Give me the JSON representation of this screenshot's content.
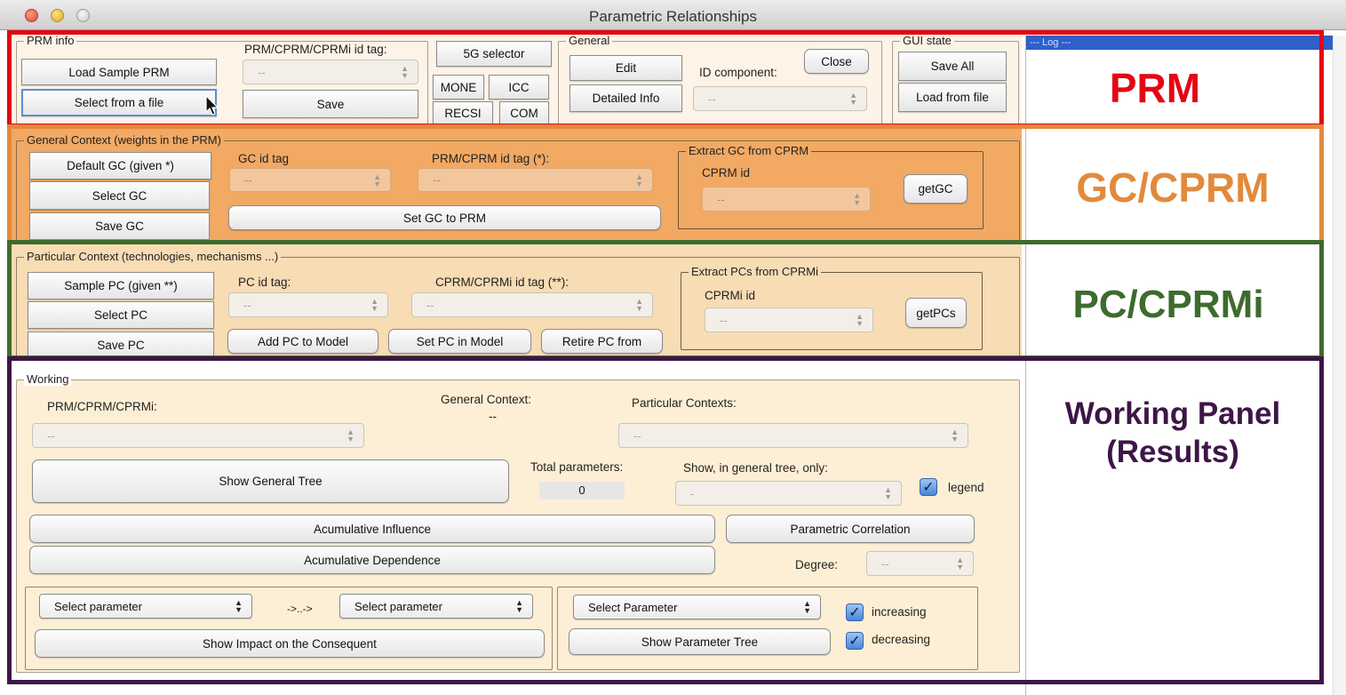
{
  "window": {
    "title": "Parametric Relationships"
  },
  "colors": {
    "prm": "#e30613",
    "gc": "#e28a3c",
    "pc": "#3e6b2e",
    "working": "#3e1547"
  },
  "side_labels": {
    "prm": "PRM",
    "gc": "GC/CPRM",
    "pc": "PC/CPRMi",
    "working_line1": "Working Panel",
    "working_line2": "(Results)"
  },
  "log": {
    "title": "--- Log ---"
  },
  "prm_info": {
    "group_title": "PRM info",
    "load_sample": "Load Sample PRM",
    "select_file": "Select from a file",
    "id_tag_label": "PRM/CPRM/CPRMi id tag:",
    "id_tag_value": "--",
    "save": "Save",
    "five_g": "5G selector",
    "mone": "MONE",
    "icc": "ICC",
    "recsi": "RECSI",
    "com": "COM"
  },
  "general": {
    "group_title": "General",
    "edit": "Edit",
    "detailed": "Detailed Info",
    "id_component_label": "ID component:",
    "id_component_value": "--",
    "close": "Close"
  },
  "gui_state": {
    "group_title": "GUI state",
    "save_all": "Save All",
    "load_file": "Load from file"
  },
  "gc": {
    "group_title": "General Context (weights in the PRM)",
    "default": "Default GC (given *)",
    "select": "Select GC",
    "save": "Save GC",
    "id_tag_label": "GC id tag",
    "id_tag_value": "--",
    "prm_tag_label": "PRM/CPRM id tag (*):",
    "prm_tag_value": "--",
    "set_gc": "Set GC to PRM",
    "extract_title": "Extract GC from CPRM",
    "cprm_id_label": "CPRM id",
    "cprm_id_value": "--",
    "get": "getGC"
  },
  "pc": {
    "group_title": "Particular Context (technologies, mechanisms ...)",
    "sample": "Sample PC (given **)",
    "select": "Select PC",
    "save": "Save PC",
    "id_tag_label": "PC id tag:",
    "id_tag_value": "--",
    "cprmi_tag_label": "CPRM/CPRMi id tag (**):",
    "cprmi_tag_value": "--",
    "add": "Add PC to Model",
    "set": "Set PC in Model",
    "retire": "Retire PC from",
    "extract_title": "Extract PCs from CPRMi",
    "cprmi_id_label": "CPRMi id",
    "cprmi_id_value": "--",
    "get": "getPCs"
  },
  "working": {
    "group_title": "Working",
    "prm_label": "PRM/CPRM/CPRMi:",
    "prm_value": "--",
    "gc_label": "General Context:",
    "gc_value": "--",
    "pc_label": "Particular Contexts:",
    "pc_value": "--",
    "show_tree": "Show General Tree",
    "total_label": "Total parameters:",
    "total_value": "0",
    "show_only_label": "Show, in general tree, only:",
    "show_only_value": "-",
    "legend_label": "legend",
    "acum_influence": "Acumulative Influence",
    "acum_dependence": "Acumulative Dependence",
    "param_corr": "Parametric Correlation",
    "degree_label": "Degree:",
    "degree_value": "--",
    "select_param_a": "Select parameter",
    "arrow_text": "->..->",
    "select_param_b": "Select parameter",
    "show_impact": "Show Impact on the Consequent",
    "select_param_c": "Select Parameter",
    "show_param_tree": "Show Parameter Tree",
    "increasing_label": "increasing",
    "decreasing_label": "decreasing"
  }
}
